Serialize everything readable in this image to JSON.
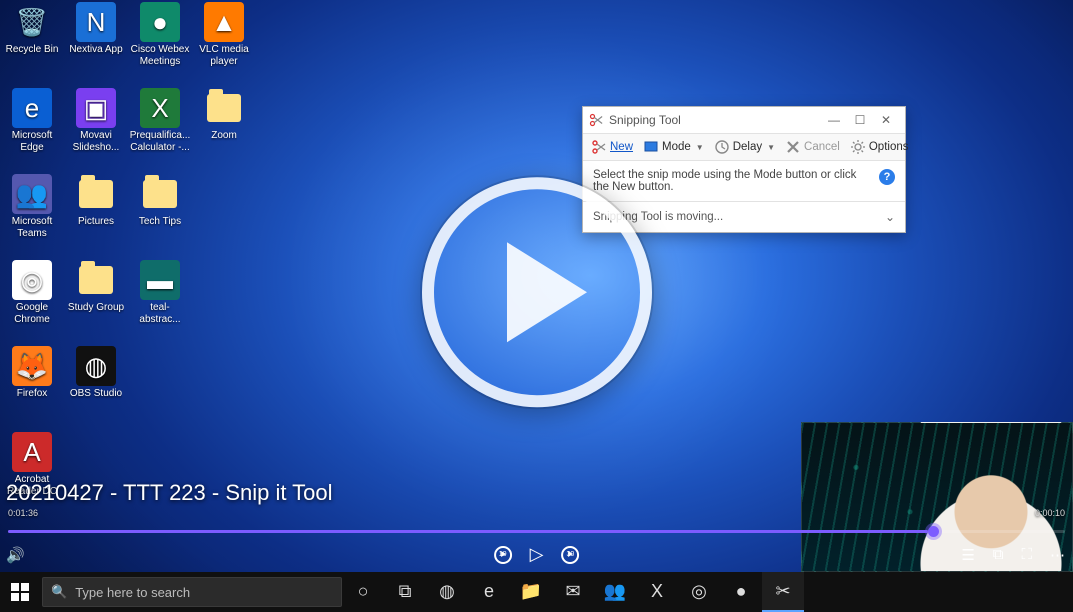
{
  "video": {
    "title": "20210427 - TTT 223 - Snip it Tool",
    "current_time": "0:01:36",
    "duration": "0:00:10",
    "skip_back": "10",
    "skip_fwd": "30"
  },
  "desktop_icons": [
    {
      "label": "Recycle Bin",
      "glyph": "🗑️",
      "bg": ""
    },
    {
      "label": "Nextiva App",
      "glyph": "N",
      "bg": "#1a6fd6"
    },
    {
      "label": "Cisco Webex Meetings",
      "glyph": "●",
      "bg": "#0f8a6a"
    },
    {
      "label": "VLC media player",
      "glyph": "▲",
      "bg": "#ff7a00"
    },
    {
      "label": "Microsoft Edge",
      "glyph": "e",
      "bg": "#0a5fd3"
    },
    {
      "label": "Movavi Slidesho...",
      "glyph": "▣",
      "bg": "#7a3ff0"
    },
    {
      "label": "Prequalifica... Calculator -...",
      "glyph": "X",
      "bg": "#1f7a3a"
    },
    {
      "label": "Zoom",
      "glyph": "",
      "bg": "folder"
    },
    {
      "label": "Microsoft Teams",
      "glyph": "👥",
      "bg": "#5558af"
    },
    {
      "label": "Pictures",
      "glyph": "",
      "bg": "folder"
    },
    {
      "label": "Tech Tips",
      "glyph": "",
      "bg": "folder"
    },
    {
      "label": "",
      "glyph": "",
      "bg": ""
    },
    {
      "label": "Google Chrome",
      "glyph": "◎",
      "bg": "#fff"
    },
    {
      "label": "Study Group",
      "glyph": "",
      "bg": "folder"
    },
    {
      "label": "teal-abstrac...",
      "glyph": "▬",
      "bg": "#0f6d6a"
    },
    {
      "label": "",
      "glyph": "",
      "bg": ""
    },
    {
      "label": "Firefox",
      "glyph": "🦊",
      "bg": "#ff7b1a"
    },
    {
      "label": "OBS Studio",
      "glyph": "◍",
      "bg": "#111"
    },
    {
      "label": "",
      "glyph": "",
      "bg": ""
    },
    {
      "label": "",
      "glyph": "",
      "bg": ""
    },
    {
      "label": "Acrobat Reader DC",
      "glyph": "A",
      "bg": "#cc2a2a"
    }
  ],
  "snipping_tool": {
    "title": "Snipping Tool",
    "toolbar": {
      "new": "New",
      "mode": "Mode",
      "delay": "Delay",
      "cancel": "Cancel",
      "options": "Options"
    },
    "hint": "Select the snip mode using the Mode button or click the New button.",
    "expand": "Snipping Tool is moving..."
  },
  "taskbar": {
    "search_placeholder": "Type here to search",
    "apps": [
      {
        "name": "cortana",
        "glyph": "○"
      },
      {
        "name": "task-view",
        "glyph": "⧉"
      },
      {
        "name": "obs",
        "glyph": "◍"
      },
      {
        "name": "edge",
        "glyph": "e"
      },
      {
        "name": "file-explorer",
        "glyph": "📁"
      },
      {
        "name": "outlook",
        "glyph": "✉"
      },
      {
        "name": "teams",
        "glyph": "👥"
      },
      {
        "name": "excel",
        "glyph": "X"
      },
      {
        "name": "chrome",
        "glyph": "◎"
      },
      {
        "name": "app",
        "glyph": "●"
      },
      {
        "name": "snipping-tool",
        "glyph": "✂"
      }
    ]
  }
}
